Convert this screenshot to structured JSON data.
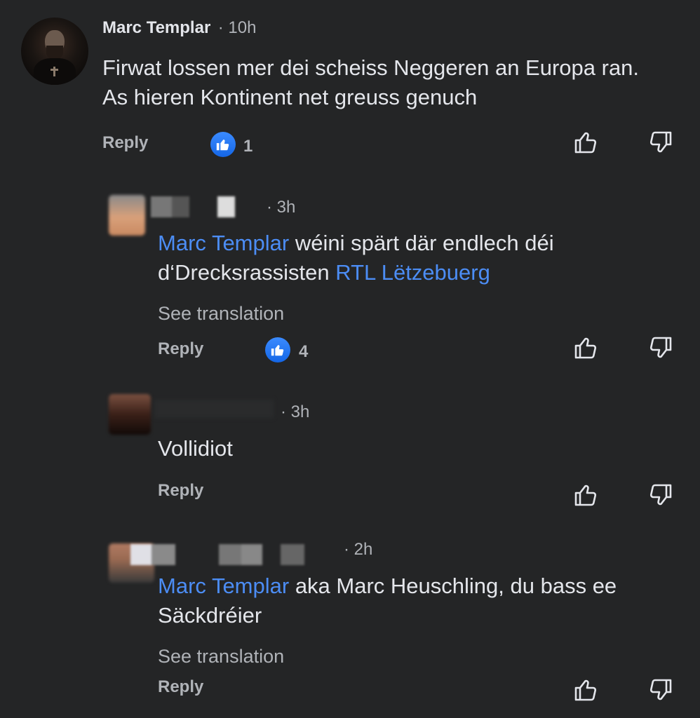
{
  "comments": [
    {
      "author": "Marc Templar",
      "time": "· 10h",
      "text": "Firwat lossen mer dei scheiss Neggeren an Europa ran. As hieren Kontinent net greuss genuch",
      "reply_label": "Reply",
      "like_count": "1"
    },
    {
      "author": "",
      "time": "· 3h",
      "mention": "Marc Templar",
      "text": " wéini spärt där endlech déi d‘Drecksrassisten ",
      "mention2": "RTL Lëtzebuerg",
      "translation_label": "See translation",
      "reply_label": "Reply",
      "like_count": "4"
    },
    {
      "author": "",
      "time": "· 3h",
      "text": "Vollidiot",
      "reply_label": "Reply"
    },
    {
      "author": "",
      "time": "· 2h",
      "mention": "Marc Templar",
      "text": " aka Marc Heuschling, du bass ee Säckdréier",
      "translation_label": "See translation",
      "reply_label": "Reply"
    }
  ],
  "icons": {
    "like_badge": "thumbs-up-icon",
    "upvote": "thumbs-up-outline-icon",
    "downvote": "thumbs-down-outline-icon"
  },
  "colors": {
    "background": "#242526",
    "mention": "#4c8df5",
    "like_badge": "#1877f2",
    "secondary_text": "#b0b3b8"
  }
}
